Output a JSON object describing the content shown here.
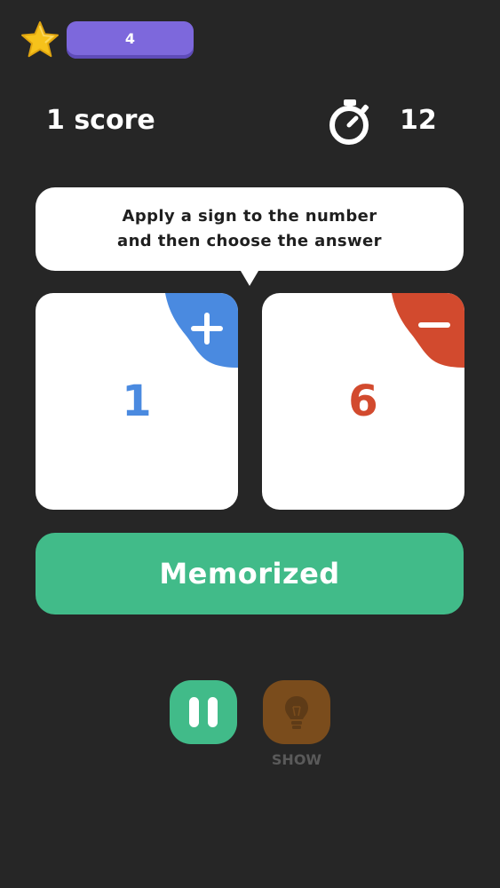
{
  "header": {
    "level": "4",
    "score_text": "1 score",
    "timer": "12",
    "icons": [
      "star-icon",
      "stopwatch-icon"
    ]
  },
  "instruction": {
    "line1": "Apply a sign to the number",
    "line2": "and then choose the answer"
  },
  "cards": [
    {
      "sign": "plus",
      "icon": "plus-icon",
      "number": "1",
      "color": "#4a8ae0"
    },
    {
      "sign": "minus",
      "icon": "minus-icon",
      "number": "6",
      "color": "#d24a2e"
    }
  ],
  "actions": {
    "memorized_label": "Memorized",
    "show_label": "SHOW"
  },
  "colors": {
    "background": "#262626",
    "accent_green": "#41bb89",
    "level_pill": "#7d68dc",
    "hint_button": "#7a4c1c"
  }
}
